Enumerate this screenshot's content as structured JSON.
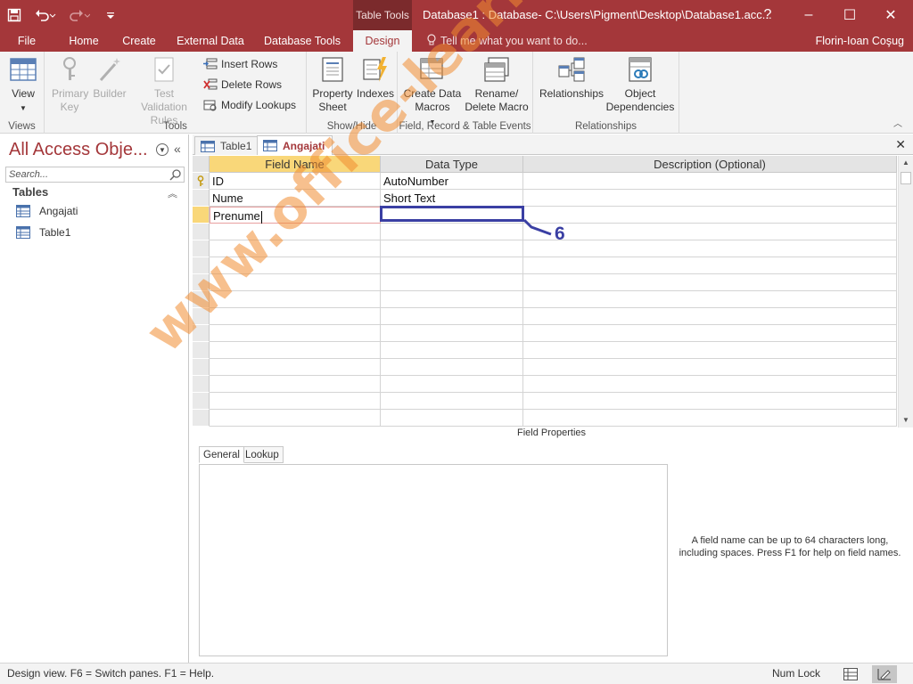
{
  "titlebar": {
    "context_group": "Table Tools",
    "document_title": "Database1 : Database- C:\\Users\\Pigment\\Desktop\\Database1.acc...",
    "help": "?",
    "minimize": "–",
    "maximize": "☐",
    "close": "✕"
  },
  "ribbon_tabs": [
    "File",
    "Home",
    "Create",
    "External Data",
    "Database Tools",
    "Design"
  ],
  "active_tab": "Design",
  "tell_me": "Tell me what you want to do...",
  "user_name": "Florin-Ioan Coşug",
  "ribbon": {
    "views": {
      "label": "Views",
      "view_btn": "View"
    },
    "tools": {
      "label": "Tools",
      "primary_key": "Primary Key",
      "builder": "Builder",
      "test_validation": "Test Validation Rules",
      "insert_rows": "Insert Rows",
      "delete_rows": "Delete Rows",
      "modify_lookups": "Modify Lookups"
    },
    "show_hide": {
      "label": "Show/Hide",
      "property_sheet": "Property Sheet",
      "indexes": "Indexes"
    },
    "events": {
      "label": "Field, Record & Table Events",
      "create_data_macros": "Create Data Macros",
      "rename_delete_macro": "Rename/ Delete Macro"
    },
    "relationships": {
      "label": "Relationships",
      "relationships_btn": "Relationships",
      "object_dependencies": "Object Dependencies"
    }
  },
  "nav": {
    "title": "All Access Obje...",
    "search_placeholder": "Search...",
    "section": "Tables",
    "items": [
      "Angajati",
      "Table1"
    ]
  },
  "doc_tabs": [
    "Table1",
    "Angajati"
  ],
  "active_doc_tab": "Angajati",
  "grid": {
    "headers": [
      "Field Name",
      "Data Type",
      "Description (Optional)"
    ],
    "rows": [
      {
        "field": "ID",
        "type": "AutoNumber",
        "desc": "",
        "primary_key": true
      },
      {
        "field": "Nume",
        "type": "Short Text",
        "desc": ""
      },
      {
        "field": "Prenume",
        "type": "",
        "desc": "",
        "editing": true
      }
    ],
    "empty_rows": 12
  },
  "annotation": {
    "step_number": "6"
  },
  "field_properties": {
    "label": "Field Properties",
    "tabs": [
      "General",
      "Lookup"
    ],
    "active_tab": "General",
    "help_text": "A field name can be up to 64 characters long, including spaces. Press F1 for help on field names."
  },
  "watermark": "www.office-learning.ro",
  "status": {
    "text": "Design view.  F6 = Switch panes.  F1 = Help.",
    "num_lock": "Num Lock"
  },
  "colors": {
    "accent": "#a4373a",
    "annotation": "#3a3fa3",
    "watermark": "#f08c32",
    "selected_header": "#f9d779"
  }
}
